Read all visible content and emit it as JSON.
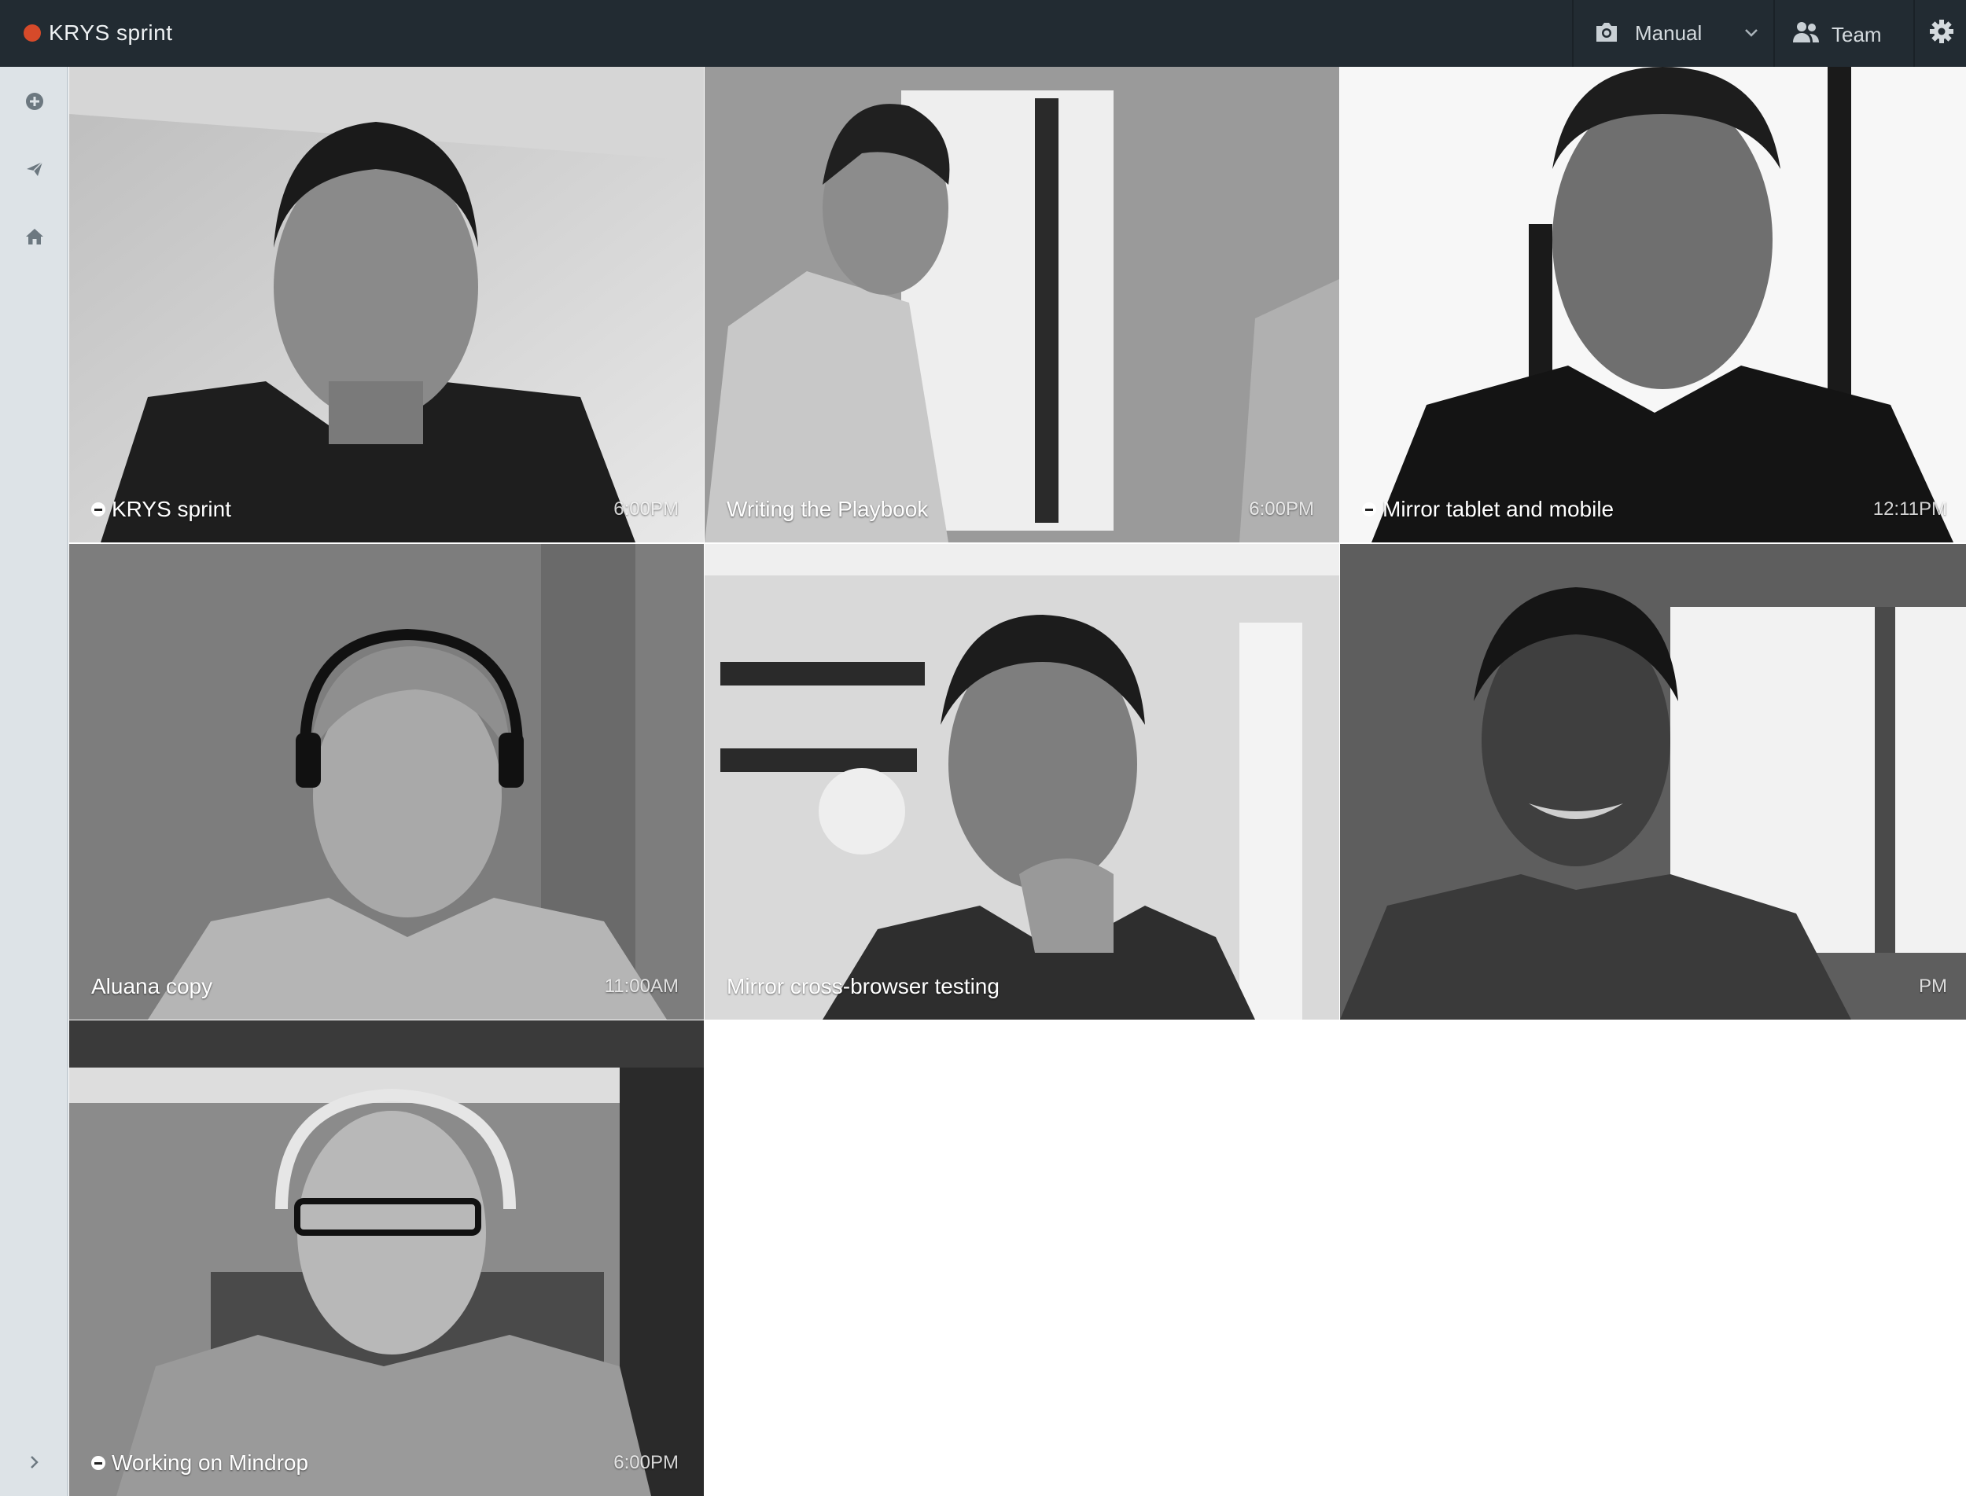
{
  "app": {
    "title": "KRYS sprint",
    "record_color": "#d64a2a"
  },
  "toolbar": {
    "camera_icon": "camera-icon",
    "mode_label": "Manual",
    "team_icon": "team-icon",
    "team_label": "Team",
    "settings_icon": "gear-icon"
  },
  "sidebar": {
    "items": [
      {
        "icon": "add-circle-icon"
      },
      {
        "icon": "send-icon"
      },
      {
        "icon": "home-icon"
      }
    ],
    "expand_icon": "chevron-right-icon"
  },
  "tiles": [
    {
      "caption": "KRYS sprint",
      "time": "6:00PM",
      "status_icon": true
    },
    {
      "caption": "Writing the Playbook",
      "time": "6:00PM",
      "status_icon": false
    },
    {
      "caption": "Mirror tablet and mobile",
      "time": "12:11PM",
      "status_icon": true
    },
    {
      "caption": "Aluana copy",
      "time": "11:00AM",
      "status_icon": false
    },
    {
      "caption": "Mirror cross-browser testing",
      "time": "",
      "status_icon": false
    },
    {
      "caption": "",
      "time": "PM",
      "status_icon": false
    },
    {
      "caption": "Working on Mindrop",
      "time": "6:00PM",
      "status_icon": true
    }
  ]
}
